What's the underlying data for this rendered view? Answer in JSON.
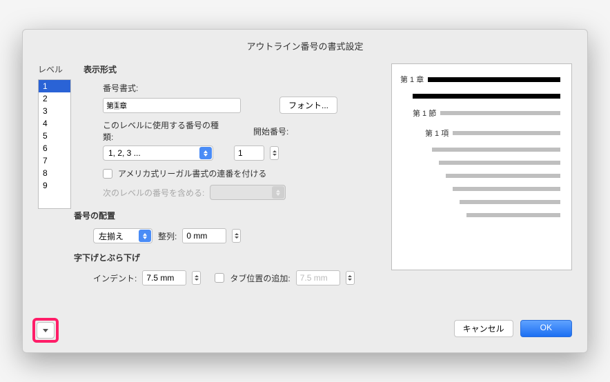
{
  "title": "アウトライン番号の書式設定",
  "level": {
    "label": "レベル",
    "items": [
      "1",
      "2",
      "3",
      "4",
      "5",
      "6",
      "7",
      "8",
      "9"
    ],
    "selected": "1"
  },
  "format": {
    "section_title": "表示形式",
    "number_format_label": "番号書式:",
    "number_format_prefix": "第",
    "number_format_value": "1",
    "number_format_suffix": "章",
    "font_button": "フォント...",
    "number_type_label": "このレベルに使用する番号の種類:",
    "start_at_label": "開始番号:",
    "number_type_value": "1, 2, 3 ...",
    "start_at_value": "1",
    "legal_checkbox_checked": false,
    "legal_checkbox_label": "アメリカ式リーガル書式の連番を付ける",
    "include_prev_label": "次のレベルの番号を含める:",
    "include_prev_value": ""
  },
  "alignment": {
    "section_title": "番号の配置",
    "align_value": "左揃え",
    "align_label": "整列:",
    "align_at_value": "0 mm"
  },
  "indent": {
    "section_title": "字下げとぶら下げ",
    "indent_label": "インデント:",
    "indent_value": "7.5 mm",
    "tab_checkbox_checked": false,
    "tab_label": "タブ位置の追加:",
    "tab_value": "7.5 mm"
  },
  "preview": {
    "rows": [
      {
        "label": "第 1 章",
        "bold": true,
        "indent": 0
      },
      {
        "label": "",
        "bold": true,
        "indent": 1
      },
      {
        "label": "第 1 節",
        "bold": false,
        "indent": 1
      },
      {
        "label": "第 1 項",
        "bold": false,
        "indent": 2
      },
      {
        "label": "",
        "bold": false,
        "indent": 3
      },
      {
        "label": "",
        "bold": false,
        "indent": 4
      },
      {
        "label": "",
        "bold": false,
        "indent": 5
      },
      {
        "label": "",
        "bold": false,
        "indent": 6
      },
      {
        "label": "",
        "bold": false,
        "indent": 7
      },
      {
        "label": "",
        "bold": false,
        "indent": 8
      }
    ]
  },
  "footer": {
    "cancel": "キャンセル",
    "ok": "OK"
  }
}
